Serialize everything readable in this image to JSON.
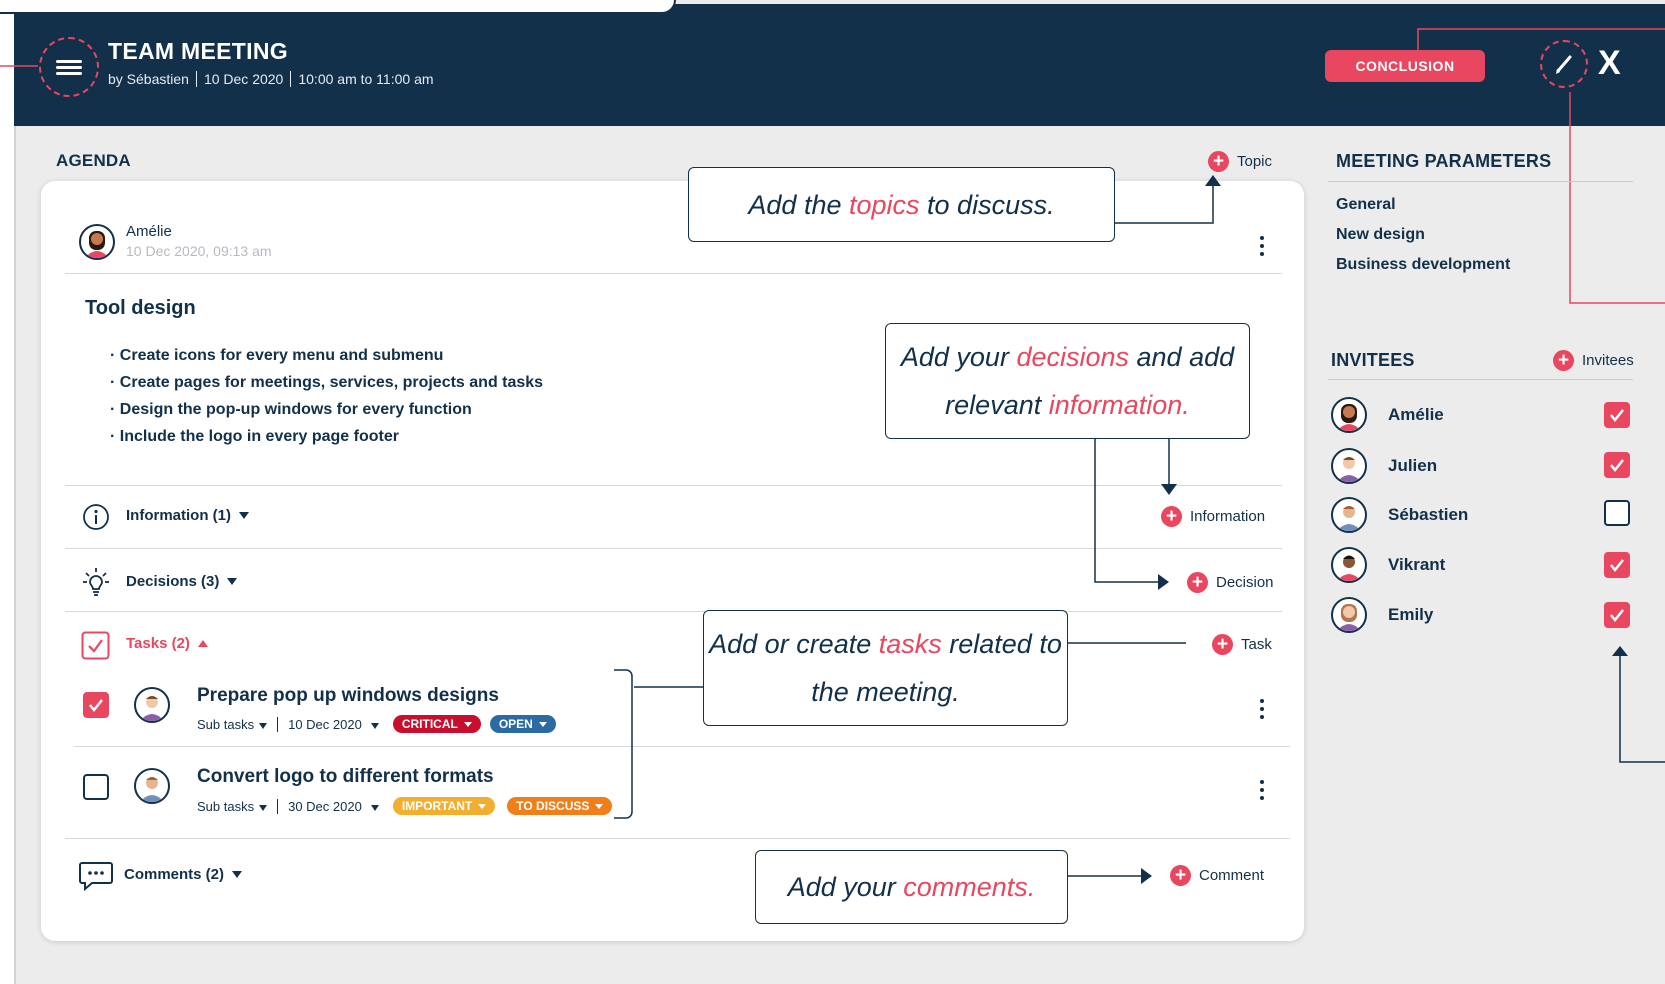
{
  "header": {
    "title": "TEAM MEETING",
    "author": "by Sébastien",
    "date": "10 Dec 2020",
    "time": "10:00 am to 11:00 am",
    "conclusion_label": "CONCLUSION",
    "close_label": "X"
  },
  "agenda": {
    "title": "AGENDA",
    "add_topic_label": "Topic",
    "post": {
      "author": "Amélie",
      "timestamp": "10 Dec 2020, 09:13 am"
    },
    "topic": {
      "title": "Tool design",
      "points": [
        "Create icons for every menu and submenu",
        "Create pages for meetings, services, projects and tasks",
        "Design the pop-up windows for every function",
        "Include the logo in every page footer"
      ]
    },
    "information": {
      "label": "Information (1)",
      "add_label": "Information"
    },
    "decisions": {
      "label": "Decisions (3)",
      "add_label": "Decision"
    },
    "tasks": {
      "label": "Tasks (2)",
      "add_label": "Task",
      "items": [
        {
          "title": "Prepare pop up windows designs",
          "subtasks": "Sub tasks",
          "date": "10 Dec 2020",
          "checked": true,
          "tags": [
            {
              "label": "CRITICAL",
              "color": "#c8102e"
            },
            {
              "label": "OPEN",
              "color": "#2b6aa3"
            }
          ]
        },
        {
          "title": "Convert logo to different formats",
          "subtasks": "Sub tasks",
          "date": "30 Dec 2020",
          "checked": false,
          "tags": [
            {
              "label": "IMPORTANT",
              "color": "#f2ae2e"
            },
            {
              "label": "TO DISCUSS",
              "color": "#f07f1a"
            }
          ]
        }
      ]
    },
    "comments": {
      "label": "Comments (2)",
      "add_label": "Comment"
    }
  },
  "callouts": {
    "topics": {
      "before": "Add the ",
      "em": "topics",
      "after": " to discuss."
    },
    "decisions": {
      "before": "Add your ",
      "em1": "decisions",
      "middle": " and add relevant ",
      "em2": "information."
    },
    "tasks": {
      "before": "Add or create ",
      "em": "tasks",
      "after": " related to the meeting."
    },
    "comments": {
      "before": "Add your ",
      "em": "comments."
    }
  },
  "sidebar": {
    "parameters_title": "MEETING PARAMETERS",
    "parameters": [
      "General",
      "New design",
      "Business development"
    ],
    "invitees_title": "INVITEES",
    "add_invitees_label": "Invitees",
    "invitees": [
      {
        "name": "Amélie",
        "checked": true
      },
      {
        "name": "Julien",
        "checked": true
      },
      {
        "name": "Sébastien",
        "checked": false
      },
      {
        "name": "Vikrant",
        "checked": true
      },
      {
        "name": "Emily",
        "checked": true
      }
    ]
  },
  "colors": {
    "navy": "#12304a",
    "accent": "#e8475f",
    "background": "#ececed"
  }
}
